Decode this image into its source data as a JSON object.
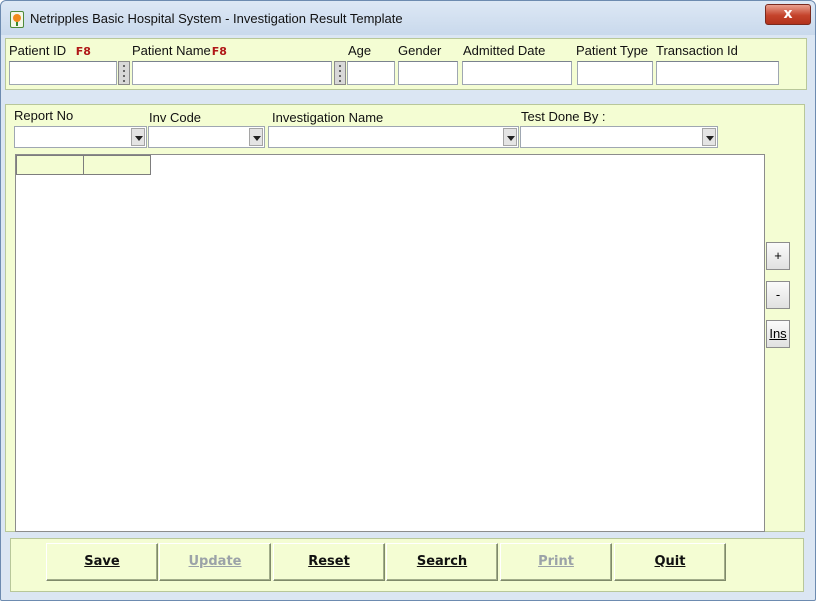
{
  "window": {
    "title": "Netripples Basic Hospital System  - Investigation Result Template",
    "close_glyph": "x"
  },
  "patient": {
    "patient_id_label": "Patient ID",
    "patient_id_hotkey": "F8",
    "patient_name_label": "Patient Name",
    "patient_name_hotkey": "F8",
    "age_label": "Age",
    "gender_label": "Gender",
    "admitted_date_label": "Admitted Date",
    "patient_type_label": "Patient Type",
    "transaction_id_label": "Transaction Id",
    "patient_id_value": "",
    "patient_name_value": "",
    "age_value": "",
    "gender_value": "",
    "admitted_date_value": "",
    "patient_type_value": "",
    "transaction_id_value": ""
  },
  "investigation": {
    "report_no_label": "Report No",
    "inv_code_label": "Inv Code",
    "investigation_name_label": "Investigation Name",
    "test_done_by_label": "Test Done By :",
    "report_no_value": "",
    "inv_code_value": "",
    "investigation_name_value": "",
    "test_done_by_value": ""
  },
  "grid_tools": {
    "add_label": "+",
    "remove_label": "-",
    "insert_label": "Ins"
  },
  "actions": {
    "save": "Save",
    "update": "Update",
    "reset": "Reset",
    "search": "Search",
    "print": "Print",
    "quit": "Quit"
  },
  "colors": {
    "panel_background": "#f4fdd3",
    "window_background": "#dbe6f3",
    "hotkey_red": "#b01818",
    "disabled_text": "#9ba2a8",
    "close_button_red": "#c4432b"
  },
  "icons": {
    "app": "hospital-app-icon",
    "close": "close-icon",
    "lookup": "lookup-dots-icon",
    "dropdown": "chevron-down-icon"
  }
}
